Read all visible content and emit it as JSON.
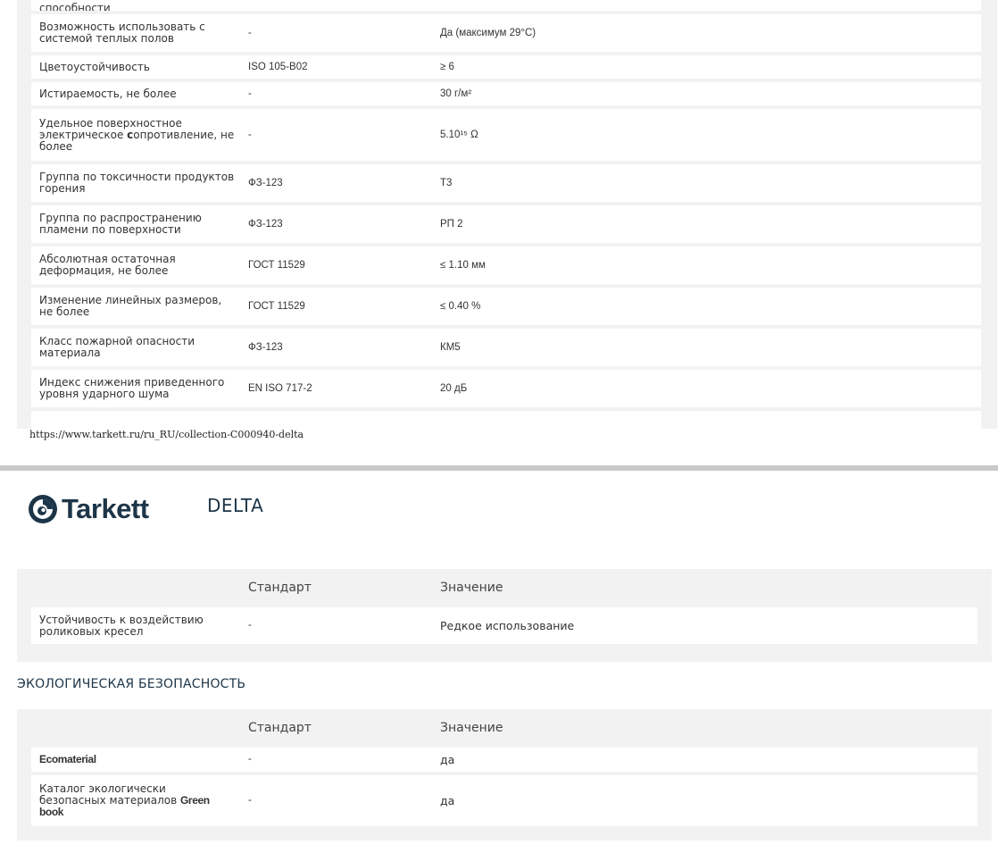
{
  "top_table": {
    "rows": [
      {
        "prop": "способности",
        "std": "",
        "val": ""
      },
      {
        "prop": "Возможность использовать с системой теплых полов",
        "std": "-",
        "val": "Да (максимум 29°C)"
      },
      {
        "prop": "Цветоустойчивость",
        "std": "ISO 105-B02",
        "val": "≥ 6"
      },
      {
        "prop": "Истираемость, не более",
        "std": "-",
        "val": "30 г/м²"
      },
      {
        "prop_parts": [
          "Удельное поверхностное электрическое ",
          "с",
          "опротивление, не более"
        ],
        "std": "-",
        "val": "5.10¹⁵ Ω"
      },
      {
        "prop": "Группа по токсичности продуктов горения",
        "std": "ФЗ-123",
        "val": "Т3"
      },
      {
        "prop": "Группа по распространению пламени по поверхности",
        "std": "ФЗ-123",
        "val": "РП 2"
      },
      {
        "prop": "Абсолютная остаточная деформация, не более",
        "std": "ГОСТ 11529",
        "val": "≤ 1.10 мм"
      },
      {
        "prop": "Изменение линейных размеров, не более",
        "std": "ГОСТ 11529",
        "val": "≤ 0.40 %"
      },
      {
        "prop": "Класс пожарной опасности материала",
        "std": "ФЗ-123",
        "val": "КМ5"
      },
      {
        "prop": "Индекс снижения приведенного уровня ударного шума",
        "std": "EN ISO 717-2",
        "val": "20 дБ"
      }
    ]
  },
  "url": "https://www.tarkett.ru/ru_RU/collection-C000940-delta",
  "header": {
    "brand": "Tarkett",
    "collection": "DELTA"
  },
  "table_a": {
    "head": {
      "col1": "",
      "col2": "Стандарт",
      "col3": "Значение"
    },
    "rows": [
      {
        "prop": "Устойчивость к воздействию роликовых кресел",
        "std": "-",
        "val": "Редкое использование"
      }
    ]
  },
  "section_eco": {
    "title": "ЭКОЛОГИЧЕСКАЯ БЕЗОПАСНОСТЬ"
  },
  "table_b": {
    "head": {
      "col1": "",
      "col2": "Стандарт",
      "col3": "Значение"
    },
    "rows": [
      {
        "prop": "Ecomaterial",
        "std": "-",
        "val": "да"
      },
      {
        "prop_parts": [
          "Каталог экологически безопасных материалов ",
          "Green book"
        ],
        "std": "-",
        "val": "да"
      }
    ]
  },
  "colors": {
    "table_bg": "#f2f2f2",
    "row_bg": "#ffffff",
    "brand_navy": "#1d3548"
  }
}
